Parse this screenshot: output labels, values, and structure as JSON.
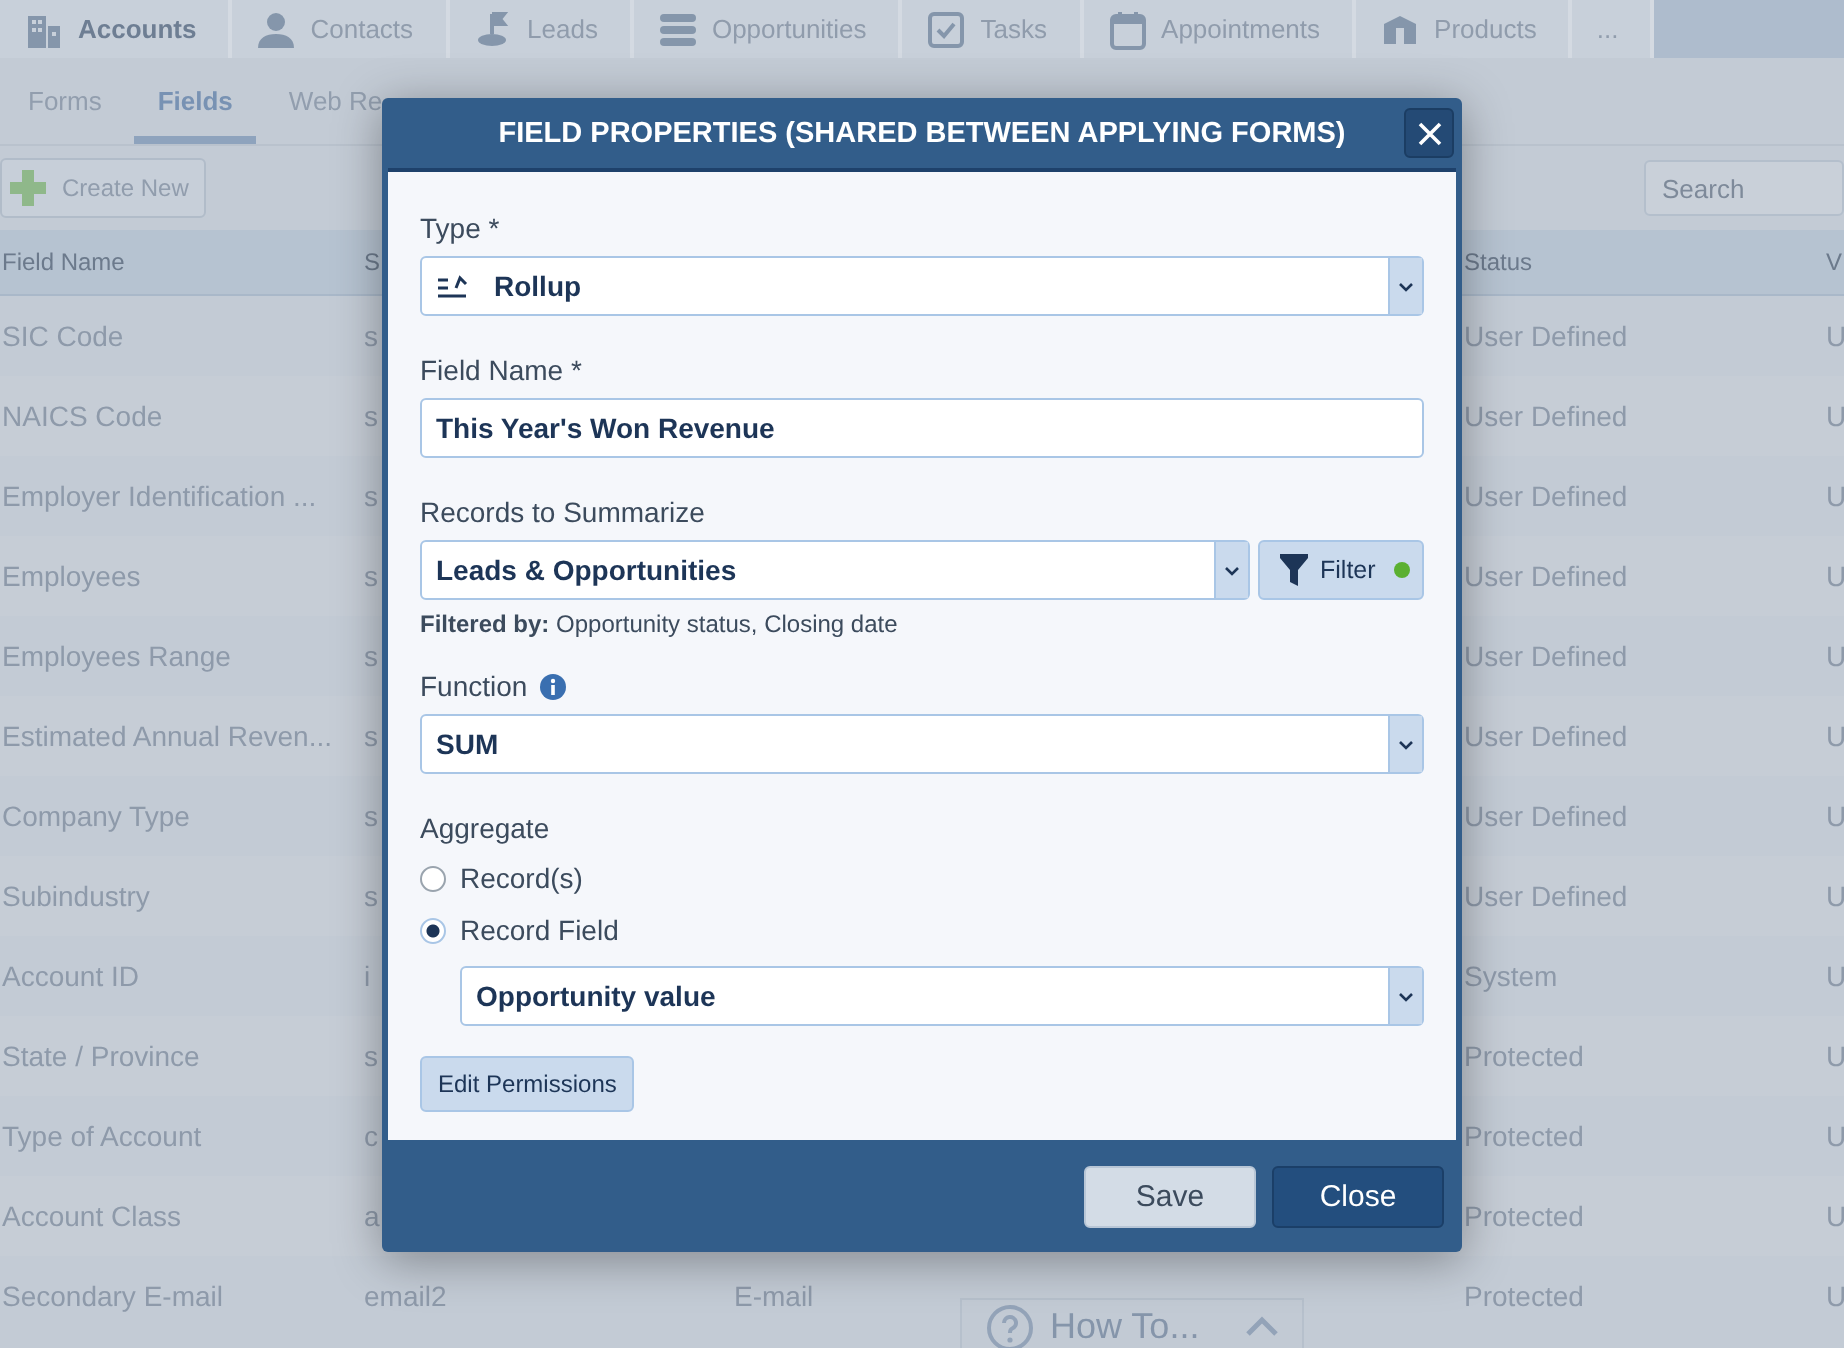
{
  "nav_tabs": [
    {
      "label": "Accounts",
      "selected": true
    },
    {
      "label": "Contacts",
      "selected": false
    },
    {
      "label": "Leads",
      "selected": false
    },
    {
      "label": "Opportunities",
      "selected": false
    },
    {
      "label": "Tasks",
      "selected": false
    },
    {
      "label": "Appointments",
      "selected": false
    },
    {
      "label": "Products",
      "selected": false
    },
    {
      "label": "...",
      "selected": false
    }
  ],
  "sub_tabs": [
    {
      "label": "Forms",
      "selected": false
    },
    {
      "label": "Fields",
      "selected": true
    },
    {
      "label": "Web Re",
      "selected": false
    }
  ],
  "toolbar": {
    "create_button": "Create New",
    "search": {
      "placeholder": "Search"
    }
  },
  "table": {
    "header": {
      "field_name": "Field Name",
      "column_2": "S",
      "status": "Status",
      "column_6": "V"
    },
    "rows": [
      {
        "field_name": "SIC Code",
        "column_2": "s",
        "status": "User Defined",
        "column_6": "U"
      },
      {
        "field_name": "NAICS Code",
        "column_2": "s",
        "status": "User Defined",
        "column_6": "U"
      },
      {
        "field_name": "Employer Identification ...",
        "column_2": "s",
        "status": "User Defined",
        "column_6": "U"
      },
      {
        "field_name": "Employees",
        "column_2": "s",
        "status": "User Defined",
        "column_6": "U"
      },
      {
        "field_name": "Employees Range",
        "column_2": "s",
        "status": "User Defined",
        "column_6": "U"
      },
      {
        "field_name": "Estimated Annual Reven...",
        "column_2": "s",
        "status": "User Defined",
        "column_6": "U"
      },
      {
        "field_name": "Company Type",
        "column_2": "s",
        "status": "User Defined",
        "column_6": "U"
      },
      {
        "field_name": "Subindustry",
        "column_2": "s",
        "status": "User Defined",
        "column_6": "U"
      },
      {
        "field_name": "Account ID",
        "column_2": "i",
        "status": "System",
        "column_6": "U"
      },
      {
        "field_name": "State / Province",
        "column_2": "s",
        "status": "Protected",
        "column_6": "U"
      },
      {
        "field_name": "Type of Account",
        "column_2": "c",
        "status": "Protected",
        "column_6": "U"
      },
      {
        "field_name": "Account Class",
        "column_2": "a",
        "status": "Protected",
        "column_6": "U"
      },
      {
        "field_name": "Secondary E-mail",
        "column_2": "email2",
        "column_3": "E-mail",
        "status": "Protected",
        "column_6": "U"
      }
    ]
  },
  "dialog": {
    "title": "FIELD PROPERTIES (SHARED BETWEEN APPLYING FORMS)",
    "type": {
      "label": "Type *",
      "value": "Rollup"
    },
    "field_name": {
      "label": "Field Name *",
      "value": "This Year's Won Revenue"
    },
    "records": {
      "label": "Records to Summarize",
      "value": "Leads & Opportunities",
      "filter_button": "Filter",
      "filter_active": true,
      "filtered_by": "**Filtered by:** Opportunity status, Closing date"
    },
    "function": {
      "label": "Function",
      "value": "SUM"
    },
    "aggregate": {
      "label": "Aggregate",
      "options": [
        {
          "label": "Record(s)",
          "selected": false
        },
        {
          "label": "Record Field",
          "selected": true
        }
      ],
      "field_value": "Opportunity value"
    },
    "permissions_button": "Edit Permissions",
    "buttons": [
      {
        "label": "Save",
        "kind": "secondary"
      },
      {
        "label": "Close",
        "kind": "primary"
      }
    ]
  },
  "help": {
    "label": "How To..."
  }
}
